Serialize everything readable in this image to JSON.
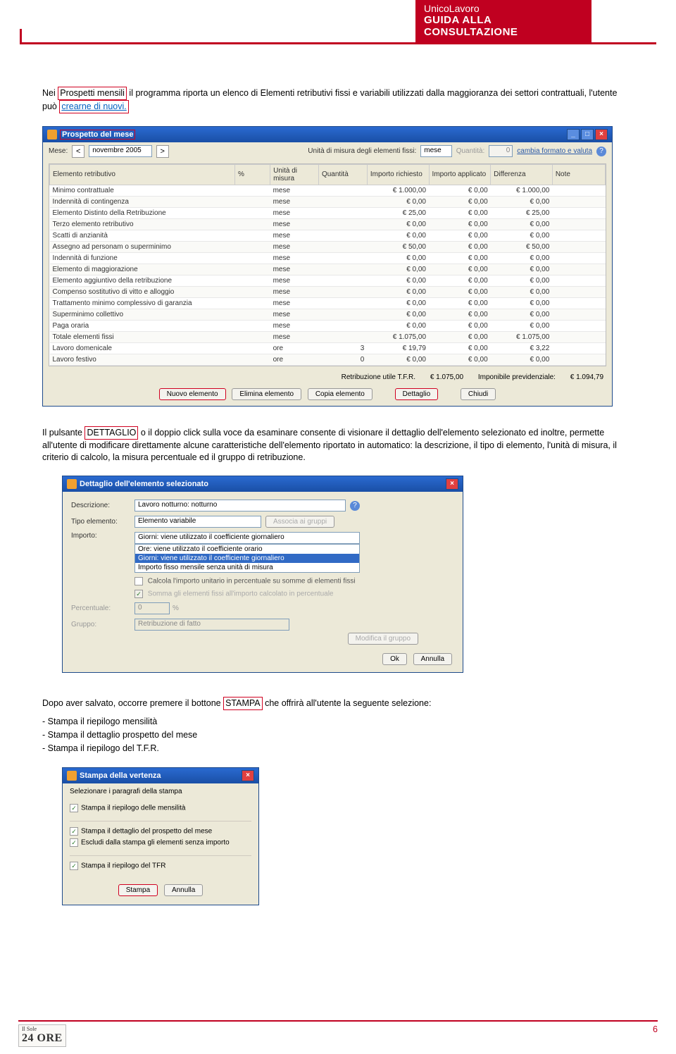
{
  "header": {
    "line1": "UnicoLavoro",
    "line2": "GUIDA ALLA CONSULTAZIONE"
  },
  "para1": {
    "pre": "Nei ",
    "hl1": "Prospetti mensili",
    "mid": " il programma riporta un elenco di Elementi retributivi fissi e variabili utilizzati dalla maggioranza dei settori contrattuali, l'utente può ",
    "hl2": "crearne di nuovi."
  },
  "win1": {
    "title": "Prospetto del mese",
    "mese_label": "Mese:",
    "mese_value": "novembre 2005",
    "unit_label": "Unità di misura degli elementi fissi:",
    "unit_value": "mese",
    "qty_label": "Quantità:",
    "qty_value": "0",
    "cambia_link": "cambia formato e valuta",
    "columns": [
      "Elemento retributivo",
      "%",
      "Unità di misura",
      "Quantità",
      "Importo richiesto",
      "Importo applicato",
      "Differenza",
      "Note"
    ],
    "rows": [
      {
        "n": "Minimo contrattuale",
        "u": "mese",
        "q": "",
        "ir": "€ 1.000,00",
        "ia": "€ 0,00",
        "d": "€ 1.000,00"
      },
      {
        "n": "Indennità di contingenza",
        "u": "mese",
        "q": "",
        "ir": "€ 0,00",
        "ia": "€ 0,00",
        "d": "€ 0,00"
      },
      {
        "n": "Elemento Distinto della Retribuzione",
        "u": "mese",
        "q": "",
        "ir": "€ 25,00",
        "ia": "€ 0,00",
        "d": "€ 25,00"
      },
      {
        "n": "Terzo elemento retributivo",
        "u": "mese",
        "q": "",
        "ir": "€ 0,00",
        "ia": "€ 0,00",
        "d": "€ 0,00"
      },
      {
        "n": "Scatti di anzianità",
        "u": "mese",
        "q": "",
        "ir": "€ 0,00",
        "ia": "€ 0,00",
        "d": "€ 0,00"
      },
      {
        "n": "Assegno ad personam o superminimo",
        "u": "mese",
        "q": "",
        "ir": "€ 50,00",
        "ia": "€ 0,00",
        "d": "€ 50,00"
      },
      {
        "n": "Indennità di funzione",
        "u": "mese",
        "q": "",
        "ir": "€ 0,00",
        "ia": "€ 0,00",
        "d": "€ 0,00"
      },
      {
        "n": "Elemento di maggiorazione",
        "u": "mese",
        "q": "",
        "ir": "€ 0,00",
        "ia": "€ 0,00",
        "d": "€ 0,00"
      },
      {
        "n": "Elemento aggiuntivo della retribuzione",
        "u": "mese",
        "q": "",
        "ir": "€ 0,00",
        "ia": "€ 0,00",
        "d": "€ 0,00"
      },
      {
        "n": "Compenso sostitutivo di vitto e alloggio",
        "u": "mese",
        "q": "",
        "ir": "€ 0,00",
        "ia": "€ 0,00",
        "d": "€ 0,00"
      },
      {
        "n": "Trattamento minimo complessivo di garanzia",
        "u": "mese",
        "q": "",
        "ir": "€ 0,00",
        "ia": "€ 0,00",
        "d": "€ 0,00"
      },
      {
        "n": "Superminimo collettivo",
        "u": "mese",
        "q": "",
        "ir": "€ 0,00",
        "ia": "€ 0,00",
        "d": "€ 0,00"
      },
      {
        "n": "Paga oraria",
        "u": "mese",
        "q": "",
        "ir": "€ 0,00",
        "ia": "€ 0,00",
        "d": "€ 0,00"
      },
      {
        "n": "Totale elementi fissi",
        "u": "mese",
        "q": "",
        "ir": "€ 1.075,00",
        "ia": "€ 0,00",
        "d": "€ 1.075,00"
      },
      {
        "n": "Lavoro domenicale",
        "u": "ore",
        "q": "3",
        "ir": "€ 19,79",
        "ia": "€ 0,00",
        "d": "€ 3,22"
      },
      {
        "n": "Lavoro festivo",
        "u": "ore",
        "q": "0",
        "ir": "€ 0,00",
        "ia": "€ 0,00",
        "d": "€ 0,00"
      }
    ],
    "sum_tfr_label": "Retribuzione utile T.F.R.",
    "sum_tfr_val": "€ 1.075,00",
    "sum_prev_label": "Imponibile previdenziale:",
    "sum_prev_val": "€ 1.094,79",
    "btn_nuovo": "Nuovo elemento",
    "btn_elimina": "Elimina elemento",
    "btn_copia": "Copia elemento",
    "btn_dettaglio": "Dettaglio",
    "btn_chiudi": "Chiudi"
  },
  "para2": {
    "pre": "Il pulsante ",
    "hl": "DETTAGLIO",
    "post": " o il doppio click sulla voce da esaminare consente di visionare il dettaglio dell'elemento selezionato ed inoltre, permette all'utente di modificare direttamente alcune caratteristiche dell'elemento riportato in automatico: la descrizione, il tipo di elemento, l'unità di misura, il criterio di calcolo, la misura percentuale ed il gruppo di retribuzione."
  },
  "win2": {
    "title": "Dettaglio dell'elemento selezionato",
    "descr_label": "Descrizione:",
    "descr_value": "Lavoro notturno: notturno",
    "tipo_label": "Tipo elemento:",
    "tipo_value": "Elemento variabile",
    "btn_associa": "Associa ai gruppi",
    "importo_label": "Importo:",
    "importo_sel": "Giorni: viene utilizzato il coefficiente giornaliero",
    "opts": [
      "Ore: viene utilizzato il coefficiente orario",
      "Giorni: viene utilizzato il coefficiente giornaliero",
      "Importo fisso mensile senza unità di misura"
    ],
    "chk1": "Calcola l'importo unitario in percentuale su somme di elementi fissi",
    "chk2": "Somma gli elementi fissi all'importo calcolato in percentuale",
    "perc_label": "Percentuale:",
    "perc_value": "0",
    "perc_unit": "%",
    "gruppo_label": "Gruppo:",
    "gruppo_value": "Retribuzione di fatto",
    "btn_modifica": "Modifica il gruppo",
    "btn_ok": "Ok",
    "btn_ann": "Annulla"
  },
  "para3": {
    "pre": "Dopo aver salvato, occorre premere il bottone ",
    "hl": "STAMPA",
    "post": " che offrirà all'utente la seguente selezione:",
    "li1": "- Stampa il riepilogo mensilità",
    "li2": "- Stampa il dettaglio prospetto del mese",
    "li3": "- Stampa il riepilogo del T.F.R."
  },
  "win3": {
    "title": "Stampa della vertenza",
    "seclabel": "Selezionare i paragrafi della stampa",
    "chk1": "Stampa il riepilogo delle mensilità",
    "chk2": "Stampa il dettaglio del prospetto del mese",
    "chk3": "Escludi dalla stampa gli elementi senza importo",
    "chk4": "Stampa il riepilogo del TFR",
    "btn_stampa": "Stampa",
    "btn_ann": "Annulla"
  },
  "footer": {
    "logo_small": "Il Sole",
    "logo_big": "24 ORE",
    "page": "6"
  }
}
